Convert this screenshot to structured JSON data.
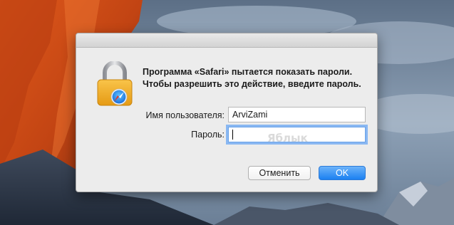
{
  "dialog": {
    "message": "Программа «Safari» пытается показать пароли. Чтобы разрешить это действие, введите пароль.",
    "username_label": "Имя пользователя:",
    "username_value": "ArviZami",
    "password_label": "Пароль:",
    "password_value": "",
    "cancel_label": "Отменить",
    "ok_label": "OK",
    "watermark": "Яблык"
  },
  "icons": {
    "lock": "padlock-with-safari-compass-icon"
  },
  "colors": {
    "ok_button": "#1b80f1",
    "focus_ring": "#8ab8f2",
    "dialog_bg": "#ececec"
  }
}
